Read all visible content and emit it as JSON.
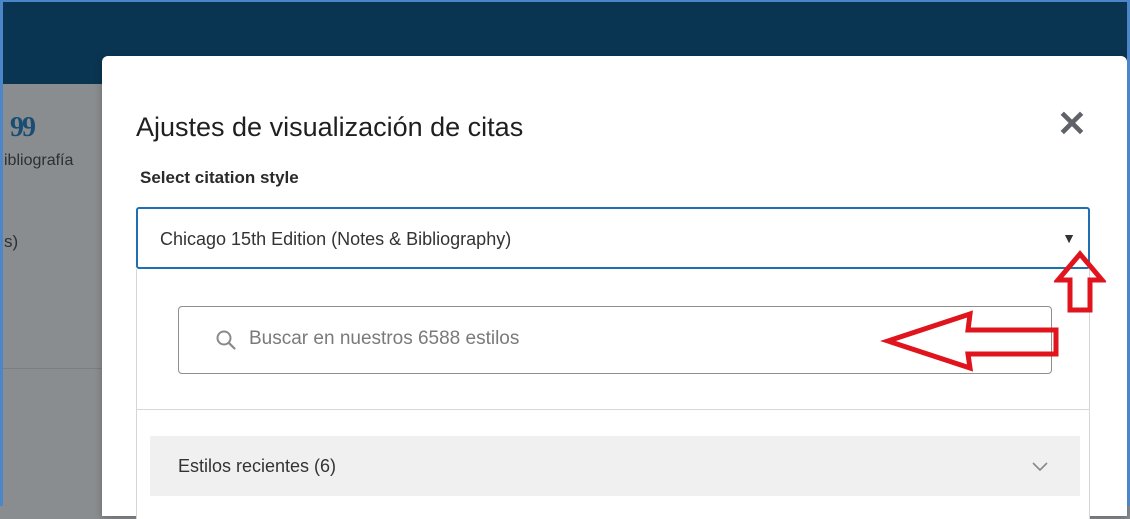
{
  "background": {
    "quote_glyph": "99",
    "label_partial": "ibliografía",
    "item_partial": "s)"
  },
  "modal": {
    "title": "Ajustes de visualización de citas",
    "close_label": "✕",
    "field_label": "Select citation style",
    "select": {
      "value": "Chicago 15th Edition (Notes & Bibliography)",
      "caret": "▼"
    },
    "search": {
      "placeholder": "Buscar en nuestros 6588 estilos"
    },
    "recent_styles": {
      "label": "Estilos recientes (6)"
    }
  },
  "colors": {
    "topbar": "#0a3552",
    "accent": "#1f6fb2",
    "annotation": "#e0141c"
  }
}
